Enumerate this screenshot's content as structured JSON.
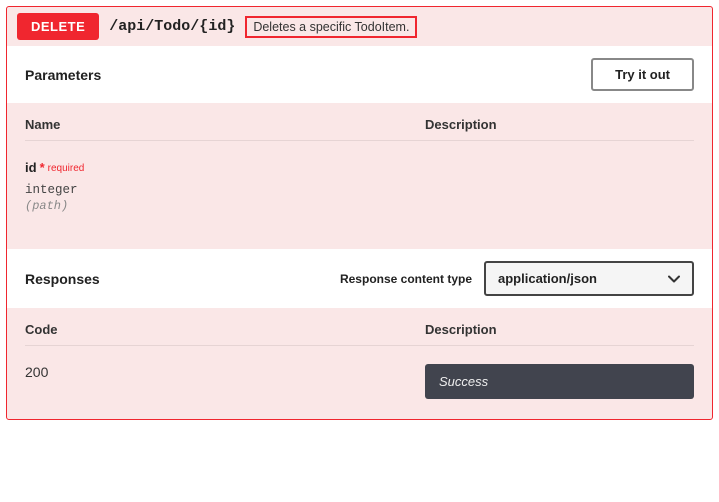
{
  "operation": {
    "method": "DELETE",
    "path": "/api/Todo/{id}",
    "summary": "Deletes a specific TodoItem."
  },
  "parameters": {
    "title": "Parameters",
    "try_label": "Try it out",
    "columns": {
      "name": "Name",
      "description": "Description"
    },
    "items": [
      {
        "name": "id",
        "required_star": "*",
        "required_text": "required",
        "type": "integer",
        "in": "(path)"
      }
    ]
  },
  "responses": {
    "title": "Responses",
    "content_type_label": "Response content type",
    "content_type_value": "application/json",
    "columns": {
      "code": "Code",
      "description": "Description"
    },
    "items": [
      {
        "code": "200",
        "description": "Success"
      }
    ]
  }
}
